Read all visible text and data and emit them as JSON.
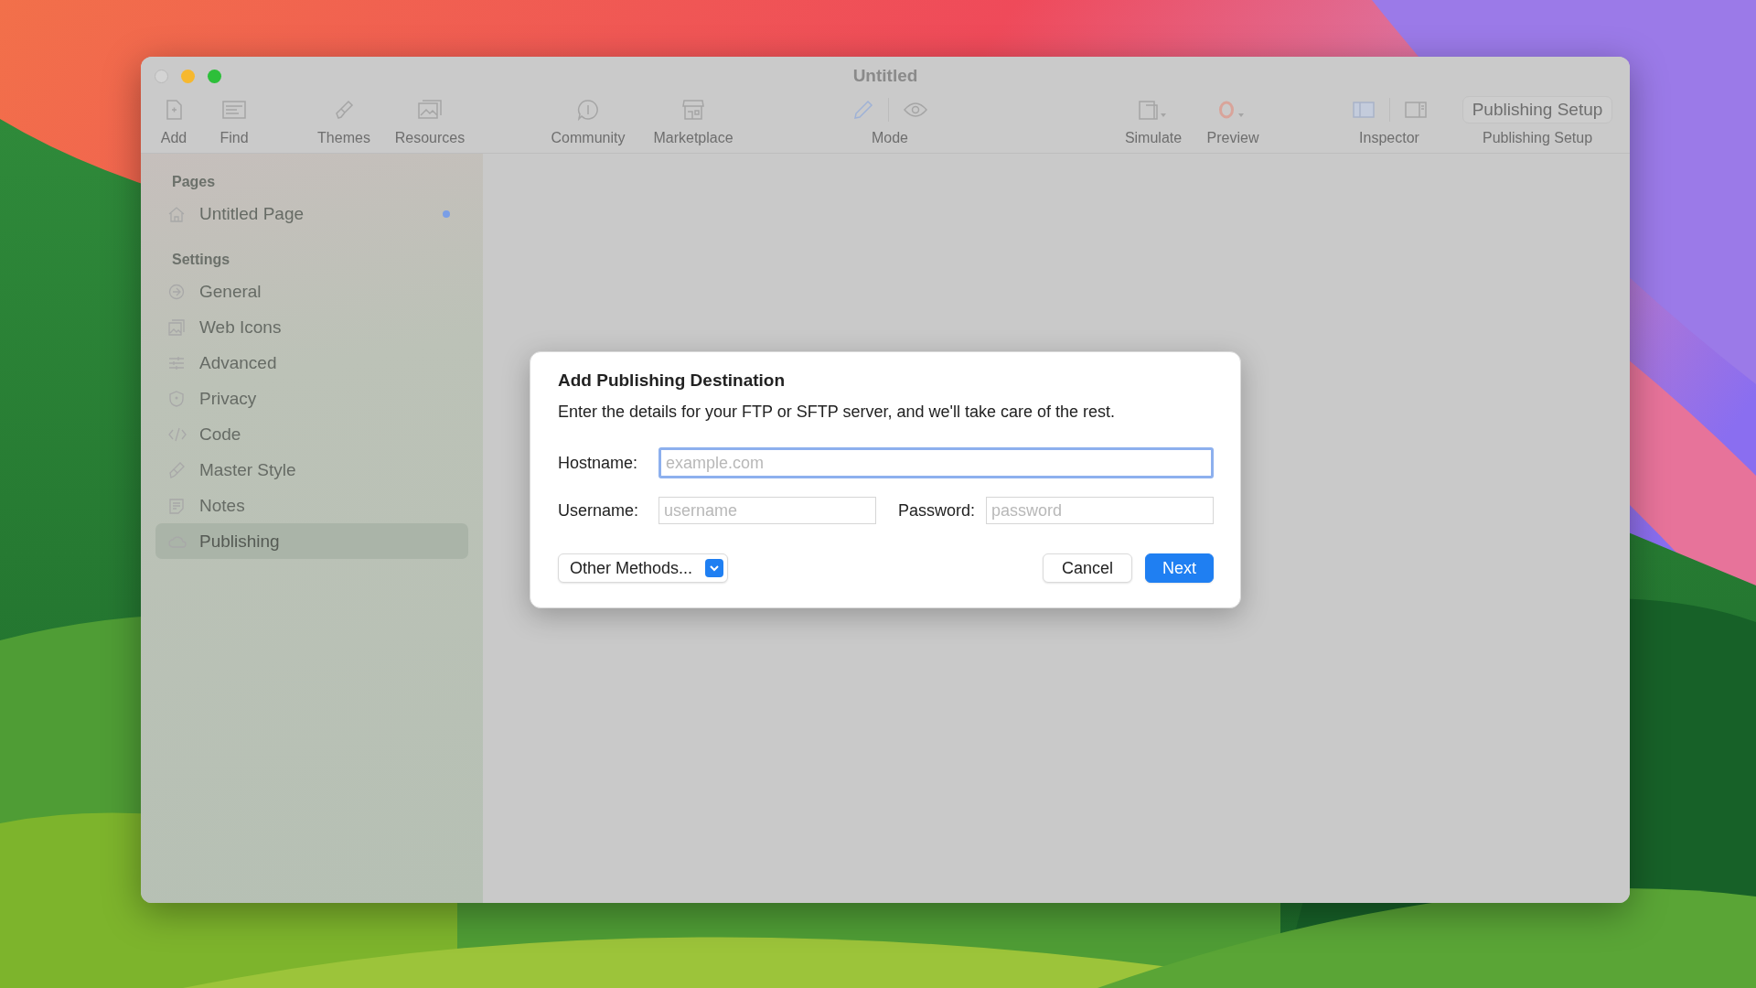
{
  "window": {
    "title": "Untitled"
  },
  "toolbar": [
    {
      "kind": "add",
      "label": "Add"
    },
    {
      "kind": "find",
      "label": "Find"
    },
    {
      "kind": "themes",
      "label": "Themes"
    },
    {
      "kind": "resources",
      "label": "Resources"
    },
    {
      "kind": "community",
      "label": "Community"
    },
    {
      "kind": "marketplace",
      "label": "Marketplace"
    },
    {
      "kind": "mode",
      "label": "Mode"
    },
    {
      "kind": "simulate",
      "label": "Simulate"
    },
    {
      "kind": "preview",
      "label": "Preview"
    },
    {
      "kind": "inspector",
      "label": "Inspector"
    },
    {
      "kind": "publishing",
      "label": "Publishing Setup",
      "button": "Publishing Setup"
    }
  ],
  "sidebar": {
    "sections": [
      {
        "heading": "Pages",
        "items": [
          {
            "kind": "home",
            "label": "Untitled Page",
            "selected": false,
            "modified": true
          }
        ]
      },
      {
        "heading": "Settings",
        "items": [
          {
            "kind": "general",
            "label": "General",
            "selected": false,
            "modified": false
          },
          {
            "kind": "webicons",
            "label": "Web Icons",
            "selected": false,
            "modified": false
          },
          {
            "kind": "advanced",
            "label": "Advanced",
            "selected": false,
            "modified": false
          },
          {
            "kind": "privacy",
            "label": "Privacy",
            "selected": false,
            "modified": false
          },
          {
            "kind": "code",
            "label": "Code",
            "selected": false,
            "modified": false
          },
          {
            "kind": "masterstyle",
            "label": "Master Style",
            "selected": false,
            "modified": false
          },
          {
            "kind": "notes",
            "label": "Notes",
            "selected": false,
            "modified": false
          },
          {
            "kind": "publishing",
            "label": "Publishing",
            "selected": true,
            "modified": false
          }
        ]
      }
    ]
  },
  "dialog": {
    "title": "Add Publishing Destination",
    "message": "Enter the details for your FTP or SFTP server, and we'll take care of the rest.",
    "hostname": {
      "label": "Hostname:",
      "placeholder": "example.com",
      "focused": true
    },
    "username": {
      "label": "Username:",
      "placeholder": "username"
    },
    "password": {
      "label": "Password:",
      "placeholder": "password"
    },
    "methods": {
      "label": "Other Methods..."
    },
    "buttons": [
      {
        "label": "Cancel",
        "default": false
      },
      {
        "label": "Next",
        "default": true
      }
    ]
  }
}
